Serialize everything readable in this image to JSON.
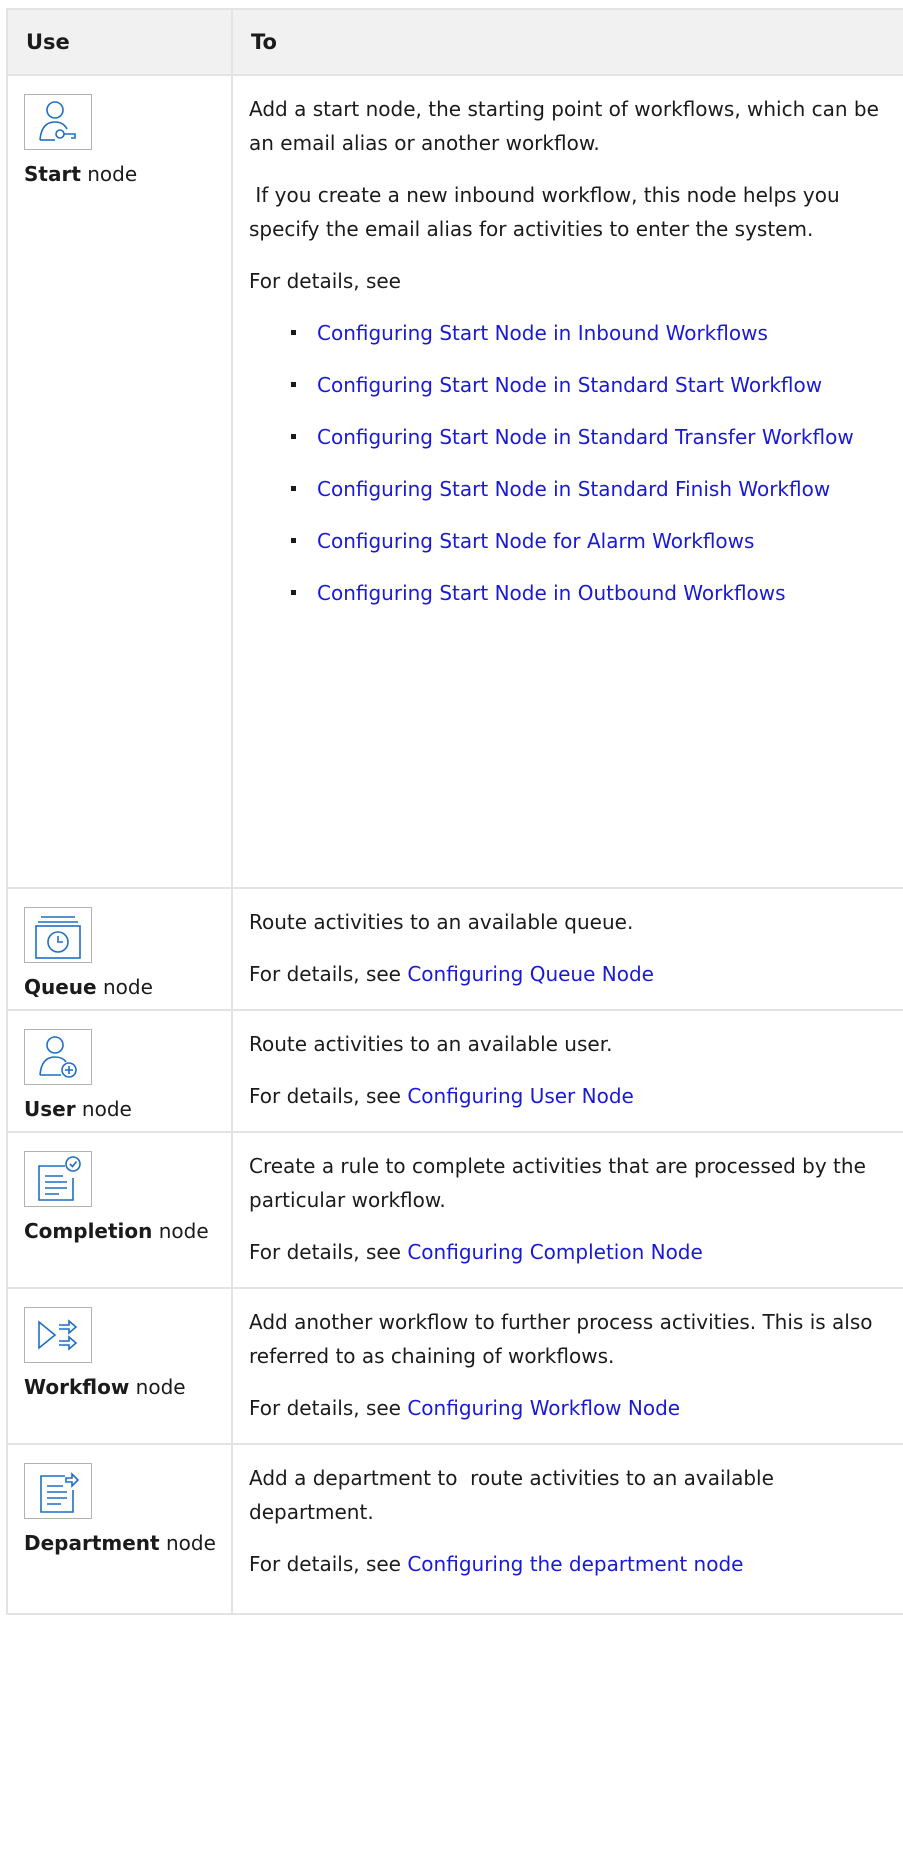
{
  "table": {
    "header": {
      "use": "Use",
      "to": "To"
    },
    "rows": [
      {
        "icon": "start-node-icon",
        "name": "Start",
        "suffix": " node",
        "paragraphs": [
          "Add a start node, the starting point of workflows, which can be an email alias or another workflow.",
          " If you create a new inbound workflow, this node helps you specify the email alias for activities to enter the system.",
          "For details, see"
        ],
        "links": [
          "Configuring Start Node in Inbound Workflows",
          "Configuring Start Node in Standard Start Workflow",
          "Configuring Start Node in Standard Transfer Workflow",
          "Configuring Start Node in Standard Finish Workflow",
          "Configuring Start Node for Alarm Workflows",
          "Configuring Start Node in Outbound Workflows"
        ]
      },
      {
        "icon": "queue-node-icon",
        "name": "Queue",
        "suffix": " node",
        "description": "Route activities to an available queue.",
        "details_prefix": "For details, see ",
        "details_link": "Configuring Queue Node"
      },
      {
        "icon": "user-node-icon",
        "name": "User",
        "suffix": " node",
        "description": "Route activities to an available user.",
        "details_prefix": "For details, see ",
        "details_link": "Configuring User Node"
      },
      {
        "icon": "completion-node-icon",
        "name": "Completion",
        "suffix": " node",
        "description": "Create a rule to complete activities that are processed by the particular workflow.",
        "details_prefix": "For details, see ",
        "details_link": "Configuring Completion Node"
      },
      {
        "icon": "workflow-node-icon",
        "name": "Workflow",
        "suffix": " node",
        "description": "Add another workflow to further process activities. This is also referred to as chaining of workflows.",
        "details_prefix": "For details, see ",
        "details_link": "Configuring Workflow Node"
      },
      {
        "icon": "department-node-icon",
        "name": "Department",
        "suffix": " node",
        "description": "Add a department to  route activities to an available department.",
        "details_prefix": "For details, see ",
        "details_link": "Configuring the department node"
      }
    ]
  },
  "colors": {
    "link": "#1a1ad6",
    "icon": "#1f6fc4",
    "border": "#e3e3e3",
    "header_bg": "#f1f1f1"
  }
}
